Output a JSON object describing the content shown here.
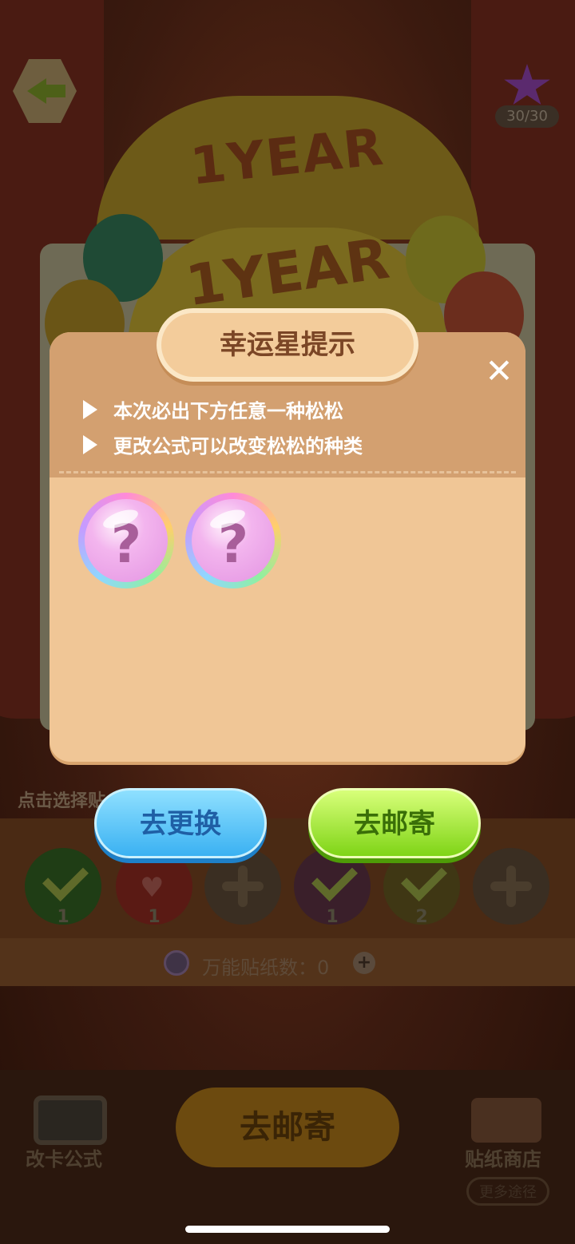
{
  "background": {
    "banner_text": "1YEAR",
    "banner_text_2": "1YEAR",
    "select_label": "点击选择贴",
    "slots": [
      {
        "state": "checked",
        "count": "1",
        "color": "#1f3d15"
      },
      {
        "state": "heart",
        "count": "1",
        "color": "#5a1a14"
      },
      {
        "state": "empty",
        "count": "",
        "color": "#3a2e22"
      },
      {
        "state": "checked",
        "count": "1",
        "color": "#3a1f2a"
      },
      {
        "state": "checked",
        "count": "2",
        "color": "#3f3714"
      },
      {
        "state": "empty",
        "count": "",
        "color": "#3a2e22"
      }
    ],
    "sticker_label": "万能贴纸数：0",
    "bottom_button": "去邮寄",
    "formula_label": "改卡公式",
    "shop_label": "贴纸商店",
    "more_label": "更多途径",
    "star_count": "30/30"
  },
  "dialog": {
    "title": "幸运星提示",
    "close_icon": "close-icon",
    "hints": [
      "本次必出下方任意一种松松",
      "更改公式可以改变松松的种类"
    ],
    "candidates": [
      {
        "symbol": "?"
      },
      {
        "symbol": "?"
      }
    ],
    "change_button": "去更换",
    "mail_button": "去邮寄"
  },
  "colors": {
    "dialog_bg": "#f0c696",
    "dialog_header": "#d3a070",
    "title_text": "#7b4626",
    "change_button": "#3ab1f2",
    "mail_button": "#7fd416"
  }
}
